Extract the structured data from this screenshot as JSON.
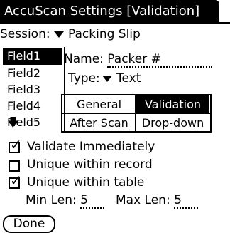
{
  "title": "AccuScan Settings [Validation]",
  "session": {
    "label": "Session:",
    "value": "Packing Slip"
  },
  "fields": {
    "items": [
      "Field1",
      "Field2",
      "Field3",
      "Field4",
      "Field5"
    ],
    "selected": "Field1"
  },
  "name_field": {
    "label": "Name:",
    "value": "Packer #"
  },
  "type_field": {
    "label": "Type:",
    "value": "Text"
  },
  "tabs": {
    "general": "General",
    "validation": "Validation",
    "after_scan": "After Scan",
    "dropdown": "Drop-down",
    "active": "Validation"
  },
  "options": [
    {
      "label": "Validate Immediately",
      "checked": true
    },
    {
      "label": "Unique within record",
      "checked": false
    },
    {
      "label": "Unique within table",
      "checked": true
    }
  ],
  "min_len": {
    "label": "Min Len:",
    "value": "5"
  },
  "max_len": {
    "label": "Max Len:",
    "value": "5"
  },
  "done_label": "Done"
}
